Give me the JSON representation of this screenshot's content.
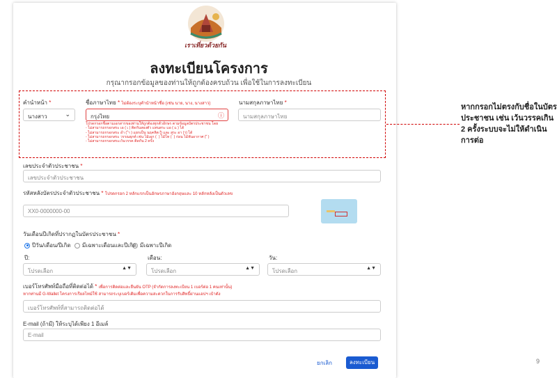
{
  "logo": {
    "text": "เราเที่ยวด้วยกัน",
    "icon": "temple-logo-icon"
  },
  "title": "ลงทะเบียนโครงการ",
  "subtitle": "กรุณากรอกข้อมูลของท่านให้ถูกต้องครบถ้วน เพื่อใช้ในการลงทะเบียน",
  "prefix": {
    "label": "คำนำหน้า",
    "required": "*",
    "value": "นางสาว"
  },
  "first_name": {
    "label": "ชื่อภาษาไทย",
    "required": "*",
    "note": "ไม่ต้องระบุคำนำหน้าชื่อ (เช่น นาย, นาง, นางสาว)",
    "value": "กรุงไทย",
    "errors": [
      "โปรดกรอกชื่อตามเอกสารของท่านให้ถูกต้องทุกตัวอักษร ตามข้อมูลบัตรประชาชน โดย",
      "- ไม่สามารถกรอกสระ เอ ( เ ) ติดกันสองตัว แทนสระ แอ ( แ ) ได้",
      "- ไม่สามารถกรอกสระ อำ ( ำ ) แยกเป็น นฤคหิต (ํ) และ สระ อา (า) ได้",
      "- ไม่สามารถกรอกสระ วรรณยุกต์ เช่น ไม้เอก ( ่ ) ไม้โท ( ้ ) ก่อน ไม้หันอากาศ ( ั )",
      "- ไม่สามารถกรอกสระเว้นวรรค ติดกัน 2 ครั้ง"
    ]
  },
  "last_name": {
    "label": "นามสกุลภาษาไทย",
    "required": "*",
    "placeholder": "นามสกุลภาษาไทย"
  },
  "callout": "หากกรอกไม่ตรงกับชื่อในบัตรประชาชน เช่น เว้นวรรคเกิน 2 ครั้งระบบจะไม่ให้ดำเนินการต่อ",
  "citizen_id": {
    "label": "เลขประจำตัวประชาชน",
    "required": "*",
    "placeholder": "เลขประจำตัวประชาชน"
  },
  "laser_code": {
    "label": "รหัสหลังบัตรประจำตัวประชาชน",
    "required": "*",
    "note": "โปรดกรอก 2 หลักแรกเป็นอักษรภาษาอังกฤษและ 10 หลักหลังเป็นตัวเลข",
    "placeholder": "XX0-0000000-00",
    "card_icon": "id-card-back-icon"
  },
  "birthdate": {
    "label": "วันเดือนปีเกิดที่ปรากฏในบัตรประชาชน",
    "required": "*",
    "options": [
      "ปีวัน/เดือน/ปีเกิด",
      "มีเฉพาะเดือนและปีเกิด",
      "มีเฉพาะปีเกิด"
    ],
    "selected_index": 0,
    "year_label": "ปี:",
    "month_label": "เดือน:",
    "day_label": "วัน:",
    "placeholder": "โปรดเลือก"
  },
  "phone": {
    "label": "เบอร์โทรศัพท์มือถือที่ติดต่อได้",
    "required": "*",
    "note": "เพื่อการติดต่อและยืนยัน OTP (จำกัดการลงทะเบียน 1 เบอร์ต่อ 1 คนเท่านั้น)",
    "hint": "หากท่านมี G-Wallet โครงการเรียลไทม์ใช้ สามารถระบุเบอร์เดิมเพื่อความสะดวกในการรับสิทธิ์ผ่านแอปฯ เป๋าตัง",
    "placeholder": "เบอร์โทรศัพท์ที่สามารถติดต่อได้"
  },
  "email": {
    "label": "E-mail (ถ้ามี) ให้ระบุได้เพียง 1 อีเมล์",
    "placeholder": "E-mail"
  },
  "buttons": {
    "cancel": "ยกเลิก",
    "register": "ลงทะเบียน"
  },
  "page_number": "9",
  "colors": {
    "primary": "#1a5bd1",
    "error": "#e02020",
    "callout_border": "#d00000"
  }
}
